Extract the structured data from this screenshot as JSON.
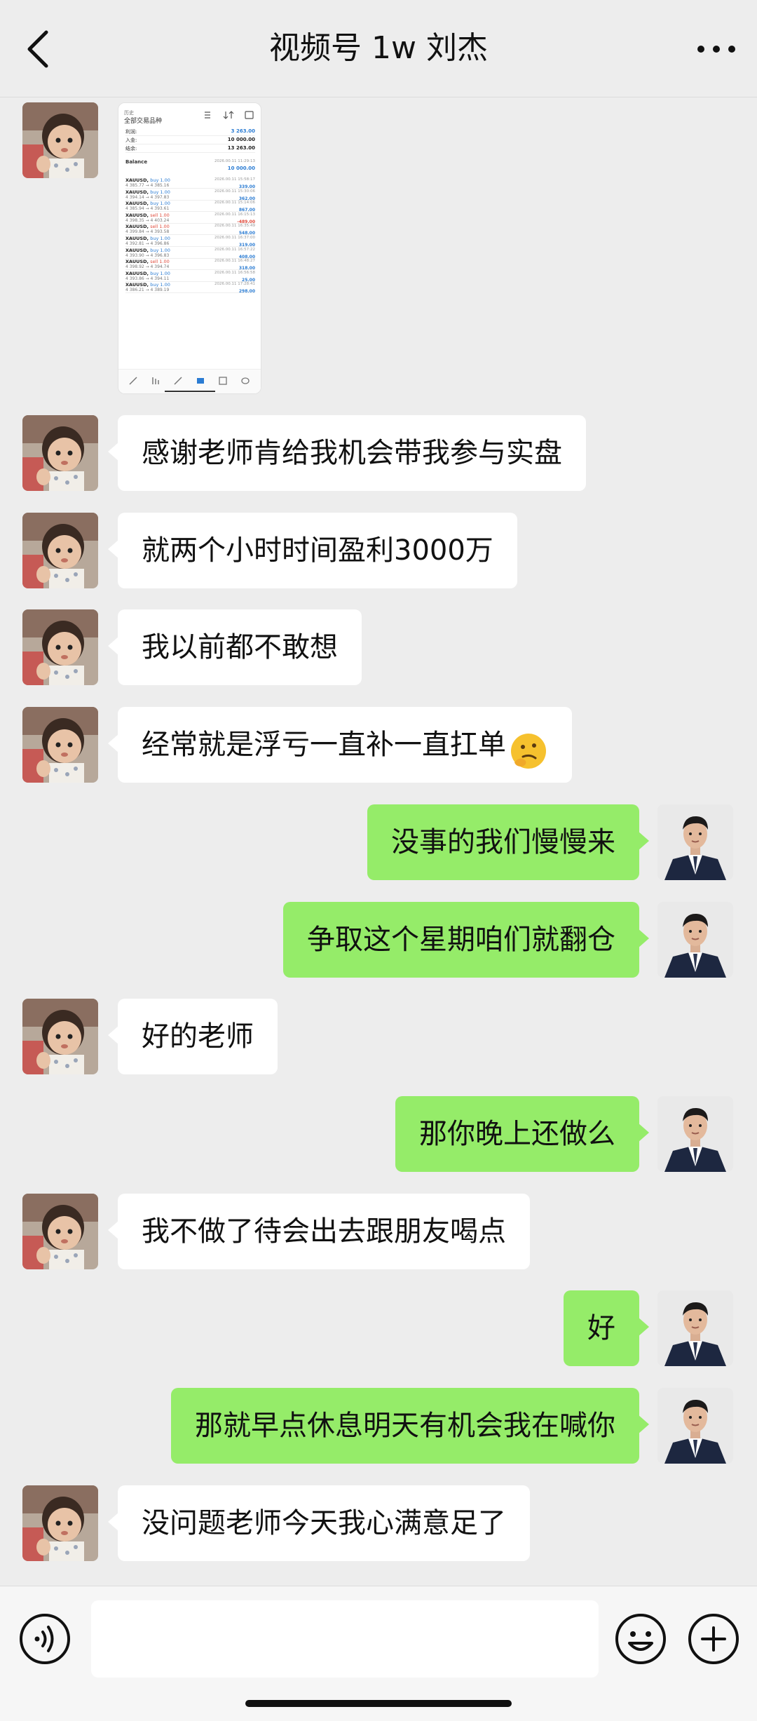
{
  "header": {
    "title": "视频号 1w 刘杰",
    "back_icon": "chevron-left-icon",
    "more_icon": "more-dots-icon"
  },
  "screenshot_message": {
    "header_small": "历史",
    "header_title": "全部交易品种",
    "summary": [
      {
        "label": "利润:",
        "value": "3 263.00",
        "color": "blue"
      },
      {
        "label": "入金:",
        "value": "10 000.00",
        "color": "black"
      },
      {
        "label": "结余:",
        "value": "13 263.00",
        "color": "black"
      }
    ],
    "balance_row": {
      "label": "Balance",
      "time": "2026.00.11 11:29:13",
      "value": "10 000.00"
    },
    "trades": [
      {
        "symbol": "XAUUSD,",
        "dir": "buy 1.00",
        "side": "buy",
        "prices": "4 385.77 → 4 385.16",
        "time": "2026.00.11 15:58:17",
        "pl": "339.00",
        "plColor": "blue"
      },
      {
        "symbol": "XAUUSD,",
        "dir": "buy 1.00",
        "side": "buy",
        "prices": "4 394.14 → 4 397.83",
        "time": "2026.00.11 15:30:06",
        "pl": "362.00",
        "plColor": "blue"
      },
      {
        "symbol": "XAUUSD,",
        "dir": "buy 1.00",
        "side": "buy",
        "prices": "4 385.94 → 4 393.61",
        "time": "2026.00.11 15:14:06",
        "pl": "867.00",
        "plColor": "blue"
      },
      {
        "symbol": "XAUUSD,",
        "dir": "sell 1.00",
        "side": "sell",
        "prices": "4 398.35 → 4 403.24",
        "time": "2026.00.11 16:15:13",
        "pl": "-489.00",
        "plColor": "red"
      },
      {
        "symbol": "XAUUSD,",
        "dir": "sell 1.00",
        "side": "sell",
        "prices": "4 399.84 → 4 393.58",
        "time": "2026.00.11 16:35:49",
        "pl": "548.00",
        "plColor": "blue"
      },
      {
        "symbol": "XAUUSD,",
        "dir": "buy 1.00",
        "side": "buy",
        "prices": "4 392.81 → 4 396.86",
        "time": "2026.00.11 16:37:00",
        "pl": "319.00",
        "plColor": "blue"
      },
      {
        "symbol": "XAUUSD,",
        "dir": "buy 1.00",
        "side": "buy",
        "prices": "4 393.90 → 4 396.83",
        "time": "2026.00.11 16:57:22",
        "pl": "408.00",
        "plColor": "blue"
      },
      {
        "symbol": "XAUUSD,",
        "dir": "sell 1.00",
        "side": "sell",
        "prices": "4 398.92 → 4 394.74",
        "time": "2026.00.11 16:48:27",
        "pl": "318.00",
        "plColor": "blue"
      },
      {
        "symbol": "XAUUSD,",
        "dir": "buy 1.00",
        "side": "buy",
        "prices": "4 393.86 → 4 394.11",
        "time": "2026.00.11 16:56:58",
        "pl": "25.00",
        "plColor": "blue"
      },
      {
        "symbol": "XAUUSD,",
        "dir": "buy 1.00",
        "side": "buy",
        "prices": "4 386.21 → 4 389.19",
        "time": "2026.00.11 17:28:41",
        "pl": "298.00",
        "plColor": "blue"
      }
    ]
  },
  "messages": [
    {
      "side": "left",
      "text": "感谢老师肯给我机会带我参与实盘"
    },
    {
      "side": "left",
      "text": "就两个小时时间盈利3000万"
    },
    {
      "side": "left",
      "text": "我以前都不敢想"
    },
    {
      "side": "left",
      "text": "经常就是浮亏一直补一直扛单",
      "emoji": "thinking-face-icon"
    },
    {
      "side": "right",
      "text": "没事的我们慢慢来"
    },
    {
      "side": "right",
      "text": "争取这个星期咱们就翻仓"
    },
    {
      "side": "left",
      "text": "好的老师"
    },
    {
      "side": "right",
      "text": "那你晚上还做么"
    },
    {
      "side": "left",
      "text": "我不做了待会出去跟朋友喝点"
    },
    {
      "side": "right",
      "text": "好"
    },
    {
      "side": "right",
      "text": "那就早点休息明天有机会我在喊你"
    },
    {
      "side": "left",
      "text": "没问题老师今天我心满意足了"
    }
  ],
  "input": {
    "placeholder": "",
    "voice_icon": "voice-icon",
    "emoji_icon": "emoji-face-icon",
    "plus_icon": "plus-circle-icon"
  },
  "colors": {
    "background": "#ededed",
    "bubble_left": "#ffffff",
    "bubble_right": "#95ec69"
  }
}
